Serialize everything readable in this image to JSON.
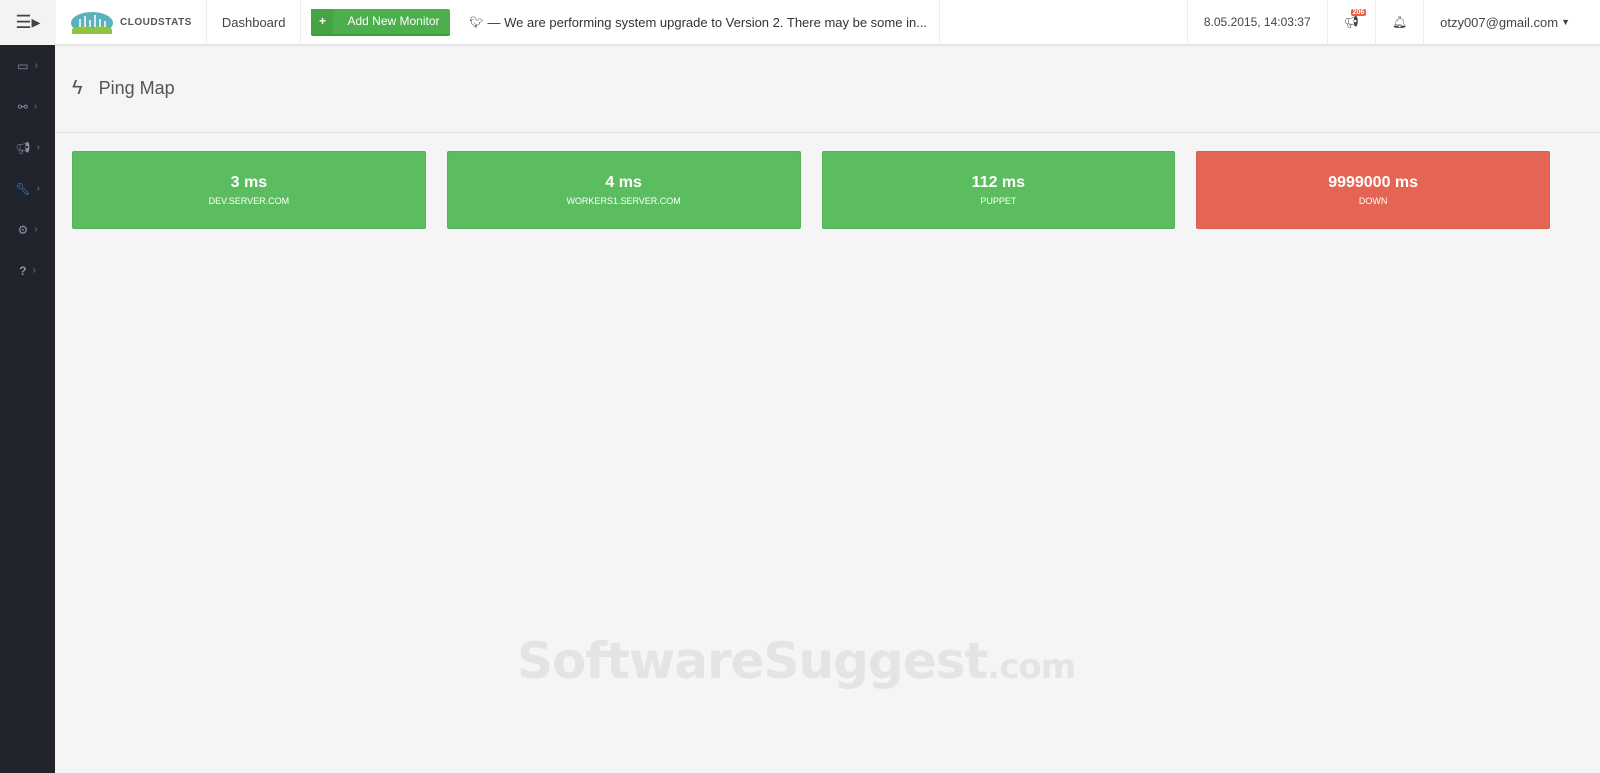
{
  "topbar": {
    "brand": "CLOUDSTATS",
    "dashboard": "Dashboard",
    "add_monitor": "Add New Monitor",
    "news": "— We are performing system upgrade to Version 2. There may be some in...",
    "datetime": "8.05.2015, 14:03:37",
    "announcements_count": "206",
    "user": "otzy007@gmail.com"
  },
  "sidebar": {
    "items": [
      {
        "icon": "server-icon"
      },
      {
        "icon": "link-icon"
      },
      {
        "icon": "megaphone-icon"
      },
      {
        "icon": "wrench-icon"
      },
      {
        "icon": "cogs-icon"
      },
      {
        "icon": "help-icon"
      }
    ]
  },
  "page": {
    "title": "Ping Map"
  },
  "tiles": [
    {
      "value": "3 ms",
      "name": "DEV.SERVER.COM",
      "color": "#5cbd60"
    },
    {
      "value": "4 ms",
      "name": "WORKERS1.SERVER.COM",
      "color": "#5cbd60"
    },
    {
      "value": "112 ms",
      "name": "PUPPET",
      "color": "#5cbd60"
    },
    {
      "value": "9999000 ms",
      "name": "DOWN",
      "color": "#e56555"
    }
  ],
  "watermark": {
    "main": "SoftwareSuggest",
    "suffix": ".com"
  }
}
